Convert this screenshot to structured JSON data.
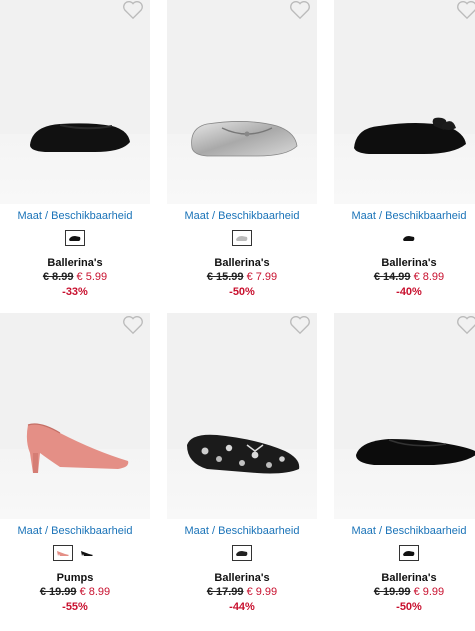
{
  "products": [
    {
      "maat": "Maat / Beschikbaarheid",
      "name": "Ballerina's",
      "old_price": "€ 8.99",
      "new_price": "€ 5.99",
      "discount": "-33%"
    },
    {
      "maat": "Maat / Beschikbaarheid",
      "name": "Ballerina's",
      "old_price": "€ 15.99",
      "new_price": "€ 7.99",
      "discount": "-50%"
    },
    {
      "maat": "Maat / Beschikbaarheid",
      "name": "Ballerina's",
      "old_price": "€ 14.99",
      "new_price": "€ 8.99",
      "discount": "-40%"
    },
    {
      "maat": "Maat / Beschikbaarheid",
      "name": "Pumps",
      "old_price": "€ 19.99",
      "new_price": "€ 8.99",
      "discount": "-55%"
    },
    {
      "maat": "Maat / Beschikbaarheid",
      "name": "Ballerina's",
      "old_price": "€ 17.99",
      "new_price": "€ 9.99",
      "discount": "-44%"
    },
    {
      "maat": "Maat / Beschikbaarheid",
      "name": "Ballerina's",
      "old_price": "€ 19.99",
      "new_price": "€ 9.99",
      "discount": "-50%"
    }
  ],
  "icons": {
    "wishlist": "heart-outline-icon",
    "swatch": "shoe-swatch-icon"
  },
  "colors": {
    "link": "#1a73b8",
    "sale": "#c8102e",
    "image_bg": "#f1f1f1"
  }
}
